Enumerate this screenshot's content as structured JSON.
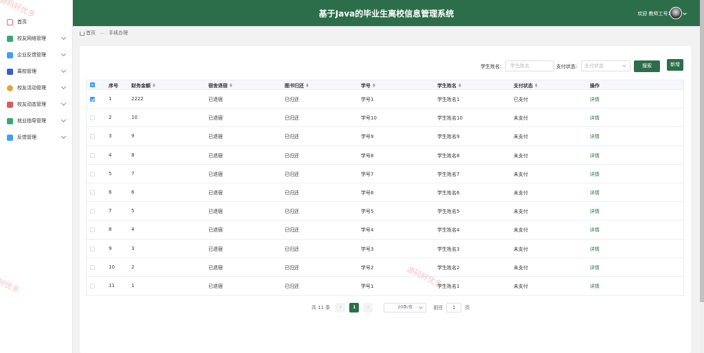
{
  "header": {
    "title": "基于Java的毕业生离校信息管理系统",
    "welcome": "欢迎 教师工号1"
  },
  "sidebar": {
    "items": [
      {
        "label": "首页",
        "icon": "home-icon",
        "color": "#e06c75",
        "has_arrow": false
      },
      {
        "label": "校友网络管理",
        "icon": "network-icon",
        "color": "#3aa76d",
        "has_arrow": true
      },
      {
        "label": "企业反馈管理",
        "icon": "folder-icon",
        "color": "#409eff",
        "has_arrow": true
      },
      {
        "label": "离校管理",
        "icon": "car-icon",
        "color": "#3c5ccf",
        "has_arrow": true
      },
      {
        "label": "校友活动管理",
        "icon": "activity-icon",
        "color": "#e6a23c",
        "has_arrow": true
      },
      {
        "label": "校友动态管理",
        "icon": "news-icon",
        "color": "#d95c5c",
        "has_arrow": true
      },
      {
        "label": "就业指导管理",
        "icon": "guide-icon",
        "color": "#3aa76d",
        "has_arrow": true
      },
      {
        "label": "反馈管理",
        "icon": "feedback-icon",
        "color": "#409eff",
        "has_arrow": true
      }
    ]
  },
  "breadcrumb": {
    "home": "首页",
    "current": "手续办理"
  },
  "search": {
    "name_label": "学生姓名:",
    "name_placeholder": "学生姓名",
    "status_label": "支付状态:",
    "status_placeholder": "支付状态",
    "search_button": "搜索",
    "add_button": "新增"
  },
  "table": {
    "headers": [
      "序号",
      "财务金额",
      "宿舍退宿",
      "图书归还",
      "学号",
      "学生姓名",
      "支付状态",
      "操作"
    ],
    "rows": [
      {
        "checked": true,
        "no": "1",
        "amount": "2222",
        "dorm": "已退宿",
        "books": "已归还",
        "student_id": "学号1",
        "name": "学生姓名1",
        "status": "已支付",
        "action": "详情"
      },
      {
        "checked": false,
        "no": "2",
        "amount": "10",
        "dorm": "已退宿",
        "books": "已归还",
        "student_id": "学号10",
        "name": "学生姓名10",
        "status": "未支付",
        "action": "详情"
      },
      {
        "checked": false,
        "no": "3",
        "amount": "9",
        "dorm": "已退宿",
        "books": "已归还",
        "student_id": "学号9",
        "name": "学生姓名9",
        "status": "未支付",
        "action": "详情"
      },
      {
        "checked": false,
        "no": "4",
        "amount": "8",
        "dorm": "已退宿",
        "books": "已归还",
        "student_id": "学号8",
        "name": "学生姓名8",
        "status": "未支付",
        "action": "详情"
      },
      {
        "checked": false,
        "no": "5",
        "amount": "7",
        "dorm": "已退宿",
        "books": "已归还",
        "student_id": "学号7",
        "name": "学生姓名7",
        "status": "未支付",
        "action": "详情"
      },
      {
        "checked": false,
        "no": "6",
        "amount": "6",
        "dorm": "已退宿",
        "books": "已归还",
        "student_id": "学号6",
        "name": "学生姓名6",
        "status": "未支付",
        "action": "详情"
      },
      {
        "checked": false,
        "no": "7",
        "amount": "5",
        "dorm": "已退宿",
        "books": "已归还",
        "student_id": "学号5",
        "name": "学生姓名5",
        "status": "未支付",
        "action": "详情"
      },
      {
        "checked": false,
        "no": "8",
        "amount": "4",
        "dorm": "已退宿",
        "books": "已归还",
        "student_id": "学号4",
        "name": "学生姓名4",
        "status": "未支付",
        "action": "详情"
      },
      {
        "checked": false,
        "no": "9",
        "amount": "3",
        "dorm": "已退宿",
        "books": "已归还",
        "student_id": "学号3",
        "name": "学生姓名3",
        "status": "未支付",
        "action": "详情"
      },
      {
        "checked": false,
        "no": "10",
        "amount": "2",
        "dorm": "已退宿",
        "books": "已归还",
        "student_id": "学号2",
        "name": "学生姓名2",
        "status": "未支付",
        "action": "详情"
      },
      {
        "checked": false,
        "no": "11",
        "amount": "1",
        "dorm": "已退宿",
        "books": "已归还",
        "student_id": "学号1",
        "name": "学生姓名1",
        "status": "未支付",
        "action": "详情"
      }
    ]
  },
  "pagination": {
    "total": "共 11 条",
    "prev": "‹",
    "current_page": "1",
    "next": "›",
    "page_size": "20条/页",
    "goto_label": "前往",
    "goto_value": "1",
    "page_suffix": "页"
  },
  "colors": {
    "primary": "#2c6e49",
    "checkbox": "#409eff"
  },
  "watermarks": [
    "源码好优多",
    "源码好优多",
    "好优多"
  ]
}
